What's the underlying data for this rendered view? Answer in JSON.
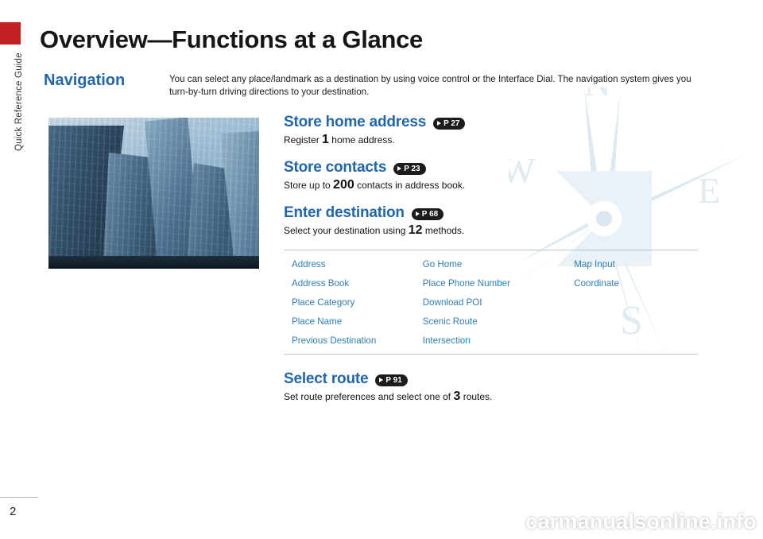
{
  "sidebar": {
    "tab_label": "Quick Reference Guide",
    "page_number": "2"
  },
  "header": {
    "title": "Overview—Functions at a Glance",
    "section": "Navigation",
    "intro": "You can select any place/landmark as a destination by using voice control or the Interface Dial. The navigation system gives you turn-by-turn driving directions to your destination."
  },
  "features": [
    {
      "title": "Store home address",
      "page_ref": "P 27",
      "desc_before": "Register ",
      "desc_number": "1",
      "desc_after": " home address."
    },
    {
      "title": "Store contacts",
      "page_ref": "P 23",
      "desc_before": "Store up to ",
      "desc_number": "200",
      "desc_after": " contacts in address book."
    },
    {
      "title": "Enter destination",
      "page_ref": "P 68",
      "desc_before": "Select your destination using ",
      "desc_number": "12",
      "desc_after": " methods."
    },
    {
      "title": "Select route",
      "page_ref": "P 91",
      "desc_before": "Set route preferences and select one of ",
      "desc_number": "3",
      "desc_after": " routes."
    }
  ],
  "methods_table": {
    "rows": [
      [
        "Address",
        "Go Home",
        "Map Input"
      ],
      [
        "Address Book",
        "Place Phone Number",
        "Coordinate"
      ],
      [
        "Place Category",
        "Download POI",
        ""
      ],
      [
        "Place Name",
        "Scenic Route",
        ""
      ],
      [
        "Previous Destination",
        "Intersection",
        ""
      ]
    ]
  },
  "compass": {
    "north": "N",
    "east": "E",
    "south": "S",
    "west": "W"
  },
  "watermark": "carmanualsonline.info",
  "colors": {
    "accent_blue": "#2167ae",
    "link_blue": "#2f7fbe",
    "marker_red": "#c32026"
  }
}
